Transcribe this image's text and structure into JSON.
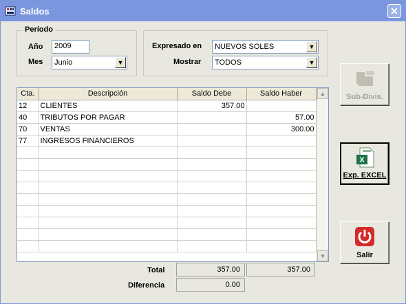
{
  "window": {
    "title": "Saldos"
  },
  "periodo": {
    "legend": "Período",
    "anio_label": "Año",
    "anio_value": "2009",
    "mes_label": "Mes",
    "mes_value": "Junio"
  },
  "options": {
    "expresado_label": "Expresado en",
    "expresado_value": "NUEVOS SOLES",
    "mostrar_label": "Mostrar",
    "mostrar_value": "TODOS"
  },
  "grid": {
    "columns": [
      "Cta.",
      "Descripción",
      "Saldo Debe",
      "Saldo Haber"
    ],
    "rows": [
      {
        "cta": "12",
        "desc": "CLIENTES",
        "debe": "357.00",
        "haber": ""
      },
      {
        "cta": "40",
        "desc": "TRIBUTOS POR PAGAR",
        "debe": "",
        "haber": "57.00"
      },
      {
        "cta": "70",
        "desc": "VENTAS",
        "debe": "",
        "haber": "300.00"
      },
      {
        "cta": "77",
        "desc": "INGRESOS FINANCIEROS",
        "debe": "",
        "haber": ""
      }
    ]
  },
  "totals": {
    "total_label": "Total",
    "total_debe": "357.00",
    "total_haber": "357.00",
    "diferencia_label": "Diferencia",
    "diferencia_value": "0.00"
  },
  "buttons": {
    "subdivis": "Sub-Divis.",
    "excel": "Exp. EXCEL",
    "salir": "Salir"
  },
  "colors": {
    "titlebar": "#7a96df",
    "excel_green": "#1e7145",
    "salir_red": "#d42a2a"
  }
}
